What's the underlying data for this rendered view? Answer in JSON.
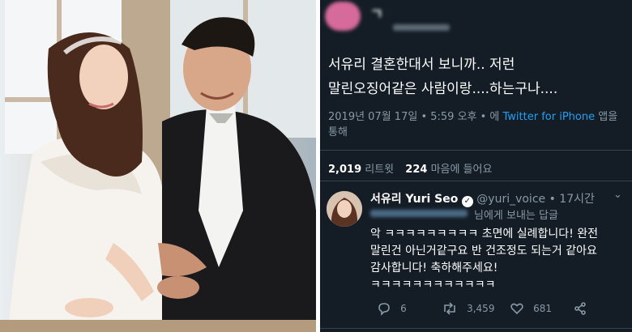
{
  "original_tweet": {
    "username_blurred": "ㄱ",
    "body_line1": "서유리 결혼한대서 보니까.. 저런",
    "body_line2": "말린오징어같은 사람이랑....하는구나....",
    "meta_prefix": "2019년 07월 17일 • 5:59 오후 • 에 ",
    "meta_client": "Twitter for iPhone",
    "meta_suffix": " 앱을",
    "meta_line2": "통해",
    "retweet_count": "2,019",
    "retweet_label": "리트윗",
    "like_count": "224",
    "like_label": "마음에 들어요"
  },
  "reply": {
    "display_name": "서유리 Yuri Seo",
    "handle": "@yuri_voice",
    "time": "• 17시간",
    "reply_to_suffix": "님에게 보내는 답글",
    "body_line1": "악 ㅋㅋㅋㅋㅋㅋㅋㅋㅋ 초면에 실례합니다! 완전",
    "body_line2": "말린건 아닌거같구요 반 건조정도 되는거 같아요",
    "body_line3": "감사합니다! 축하해주세요!",
    "body_line4": "ㅋㅋㅋㅋㅋㅋㅋㅋㅋㅋㅋㅋ",
    "reply_count": "6",
    "retweet_count": "3,459",
    "like_count": "681"
  },
  "colors": {
    "background": "#141d26",
    "link": "#1da1f2",
    "muted": "#8899a6"
  }
}
